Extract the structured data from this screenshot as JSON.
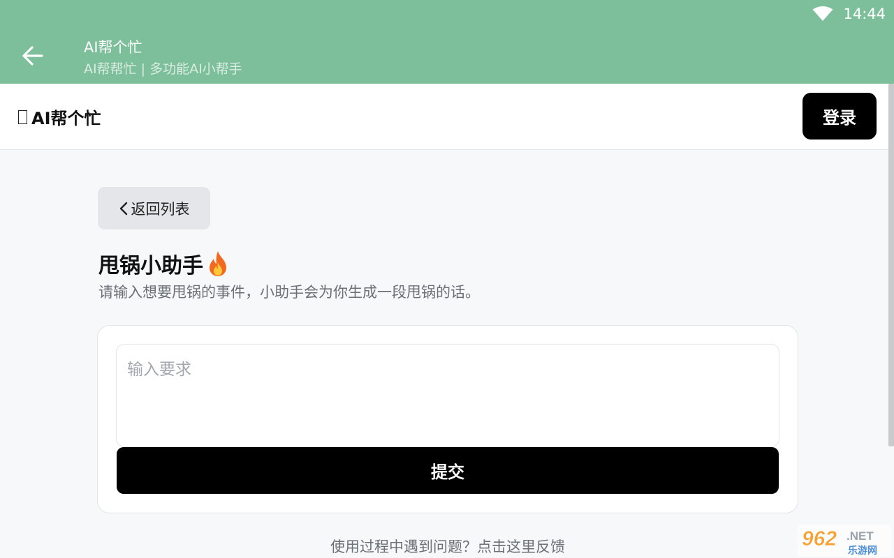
{
  "status_bar": {
    "time": "14:44",
    "wifi_icon": "wifi-icon"
  },
  "app_bar": {
    "back_icon": "arrow-left-icon",
    "title": "AI帮个忙",
    "subtitle": "AI帮帮忙 | 多功能AI小帮手"
  },
  "header": {
    "brand_glyph": "",
    "brand_name": "AI帮个忙",
    "login_label": "登录"
  },
  "page": {
    "back_label": "返回列表",
    "tool_title": "甩锅小助手",
    "tool_title_emoji": "🔥",
    "tool_description": "请输入想要甩锅的事件，小助手会为你生成一段甩锅的话。",
    "input": {
      "value": "",
      "placeholder": "输入要求"
    },
    "submit_label": "提交",
    "feedback_text": "使用过程中遇到问题？点击这里反馈"
  },
  "watermark": {
    "number": "962",
    "suffix": ".NET",
    "caption": "乐游网"
  },
  "colors": {
    "app_bar": "#7cbf9a",
    "primary_button": "#000000",
    "page_background": "#f7f8fa",
    "secondary_button": "#e5e6ea",
    "watermark_orange": "#f7a030",
    "watermark_blue": "#4f8fd6"
  }
}
